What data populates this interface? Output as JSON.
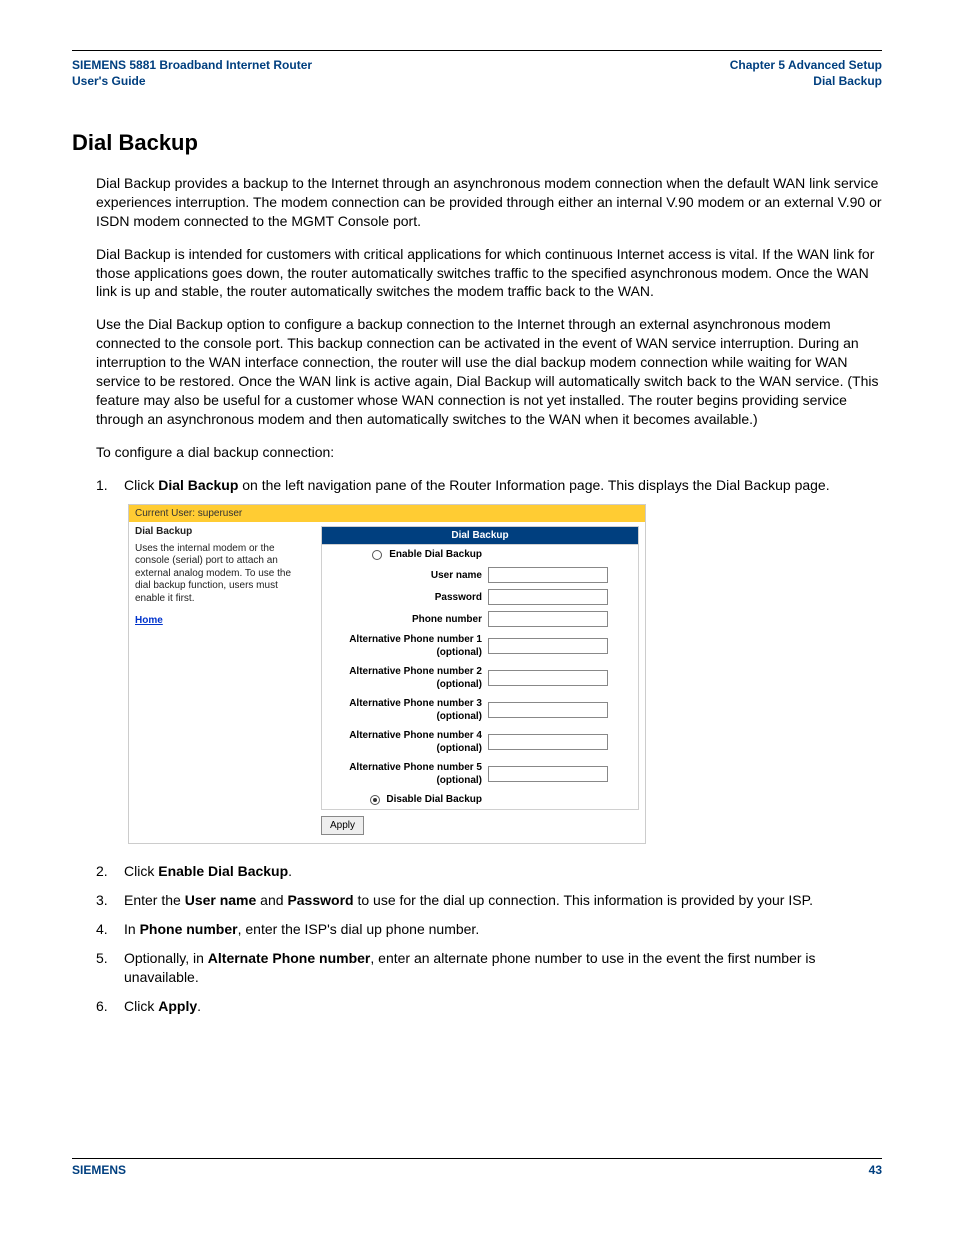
{
  "header": {
    "left_line1": "SIEMENS 5881 Broadband Internet Router",
    "left_line2": "User's Guide",
    "right_line1": "Chapter 5  Advanced Setup",
    "right_line2": "Dial Backup"
  },
  "title": "Dial Backup",
  "paragraphs": {
    "p1": "Dial Backup provides a backup to the Internet through an asynchronous modem connection when the default WAN link service experiences interruption. The modem connection can be provided through either an internal V.90 modem or an external V.90 or ISDN modem connected to the MGMT Console port.",
    "p2": "Dial Backup is intended for customers with critical applications for which continuous Internet access is vital. If the WAN link for those applications goes down, the router automatically switches traffic to the specified asynchronous modem. Once the WAN link is up and stable, the router automatically switches the modem traffic back to the WAN.",
    "p3": "Use the Dial Backup option to configure a backup connection to the Internet through an external asynchronous modem connected to the console port. This backup connection can be activated in the event of WAN service interruption. During an interruption to the WAN interface connection, the router will use the dial backup modem connection while waiting for WAN service to be restored. Once the WAN link is active again, Dial Backup will automatically switch back to the WAN service. (This feature may also be useful for a customer whose WAN connection is not yet installed. The router begins providing service through an asynchronous modem and then automatically switches to the WAN when it becomes available.)",
    "p4": "To configure a dial backup connection:"
  },
  "steps": {
    "s1_a": "Click ",
    "s1_b": "Dial Backup",
    "s1_c": " on the left navigation pane of the Router Information page. This displays the Dial Backup page.",
    "s2_a": "Click ",
    "s2_b": "Enable Dial Backup",
    "s2_c": ".",
    "s3_a": "Enter the ",
    "s3_b": "User name",
    "s3_c": " and ",
    "s3_d": "Password",
    "s3_e": " to use for the dial up connection. This information is provided by your ISP.",
    "s4_a": "In ",
    "s4_b": "Phone number",
    "s4_c": ", enter the ISP's dial up phone number.",
    "s5_a": "Optionally, in ",
    "s5_b": "Alternate Phone number",
    "s5_c": ", enter an alternate phone number to use in the event the first number is unavailable.",
    "s6_a": "Click ",
    "s6_b": "Apply",
    "s6_c": "."
  },
  "embedded": {
    "topbar": "Current User: superuser",
    "side_title": "Dial Backup",
    "side_desc": "Uses the internal modem or the console (serial) port to attach an external analog modem.  To use the dial backup function, users must enable it first.",
    "home": "Home",
    "panel_head": "Dial Backup",
    "enable_label": "Enable Dial Backup",
    "username_label": "User name",
    "password_label": "Password",
    "phone_label": "Phone number",
    "alt1_label": "Alternative Phone number 1 (optional)",
    "alt2_label": "Alternative Phone number 2 (optional)",
    "alt3_label": "Alternative Phone number 3 (optional)",
    "alt4_label": "Alternative Phone number 4 (optional)",
    "alt5_label": "Alternative Phone number 5 (optional)",
    "disable_label": "Disable Dial Backup",
    "apply": "Apply"
  },
  "footer": {
    "brand": "SIEMENS",
    "page": "43"
  }
}
